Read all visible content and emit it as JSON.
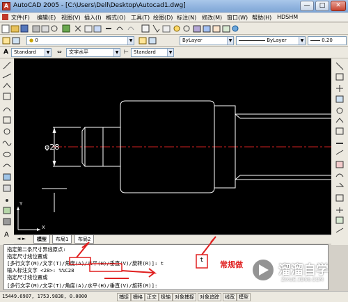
{
  "window": {
    "title": "AutoCAD 2005 - [C:\\Users\\Dell\\Desktop\\Autocad1.dwg]",
    "min_label": "—",
    "max_label": "□",
    "close_label": "✕"
  },
  "menu": [
    "文件(F)",
    "编辑(E)",
    "视图(V)",
    "插入(I)",
    "格式(O)",
    "工具(T)",
    "绘图(D)",
    "标注(N)",
    "修改(M)",
    "窗口(W)",
    "帮助(H)",
    "HDSHM"
  ],
  "layer": {
    "value": "0"
  },
  "style_bar": {
    "text_style": "Standard",
    "text_align": "文字水平",
    "dim_style": "Standard",
    "color": "ByLayer",
    "linetype": "ByLayer",
    "lineweight": "0.20"
  },
  "drawing": {
    "dimension_label": "φ28",
    "ucs_y": "Y",
    "ucs_x": "X"
  },
  "tabs": [
    "模型",
    "布局1",
    "布局2"
  ],
  "command_lines": [
    "指定第二条尺寸界线原点:",
    "指定尺寸线位置或",
    "[多行文字(M)/文字(T)/角度(A)/水平(H)/垂直(V)/旋转(R)]: t",
    "输入标注文字 <28>: %%C28",
    "指定尺寸线位置或",
    "[多行文字(M)/文字(T)/角度(A)/水平(H)/垂直(V)/旋转(R)]:"
  ],
  "annotation": {
    "typed_key": "t",
    "note": "常规做"
  },
  "status": {
    "coords": "15449.6907, 1753.9838, 0.0000",
    "buttons": [
      "捕捉",
      "栅格",
      "正交",
      "极轴",
      "对象捕捉",
      "对象追踪",
      "线宽",
      "模型"
    ]
  },
  "watermark": {
    "brand": "溜溜自学",
    "url": "ZIXUE.3D66.COM"
  },
  "colors": {
    "canvas": "#000000",
    "annotation_red": "#e02020",
    "centerline": "#d02020"
  }
}
